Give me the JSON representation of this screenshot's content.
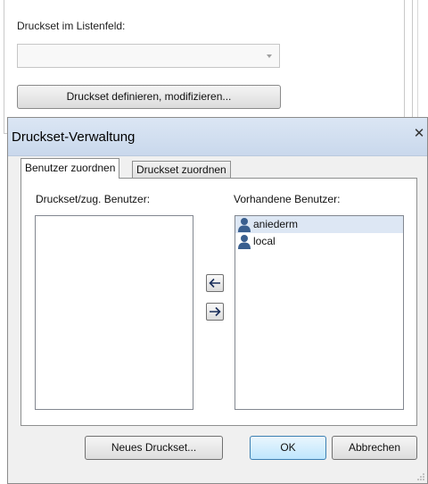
{
  "background": {
    "label": "Druckset im Listenfeld:",
    "combo_value": "",
    "button_label": "Druckset definieren, modifizieren..."
  },
  "dialog": {
    "title": "Druckset-Verwaltung",
    "close_icon": "close-icon",
    "tabs": [
      {
        "label": "Benutzer zuordnen",
        "active": true
      },
      {
        "label": "Druckset zuordnen",
        "active": false
      }
    ],
    "left_list": {
      "label": "Druckset/zug. Benutzer:",
      "items": []
    },
    "right_list": {
      "label": "Vorhandene Benutzer:",
      "items": [
        {
          "label": "aniederm",
          "icon": "user-icon",
          "selected": true
        },
        {
          "label": "local",
          "icon": "user-icon",
          "selected": false
        }
      ]
    },
    "arrow_buttons": {
      "add": "left-arrow-icon",
      "remove": "right-arrow-icon"
    },
    "buttons": {
      "new_druckset": "Neues Druckset...",
      "ok": "OK",
      "cancel": "Abbrechen"
    }
  },
  "colors": {
    "titlebar": "#c9d8ec",
    "selection": "#dde7f4",
    "user_icon": "#3a5f8f",
    "ok_border": "#3c7fb1"
  }
}
